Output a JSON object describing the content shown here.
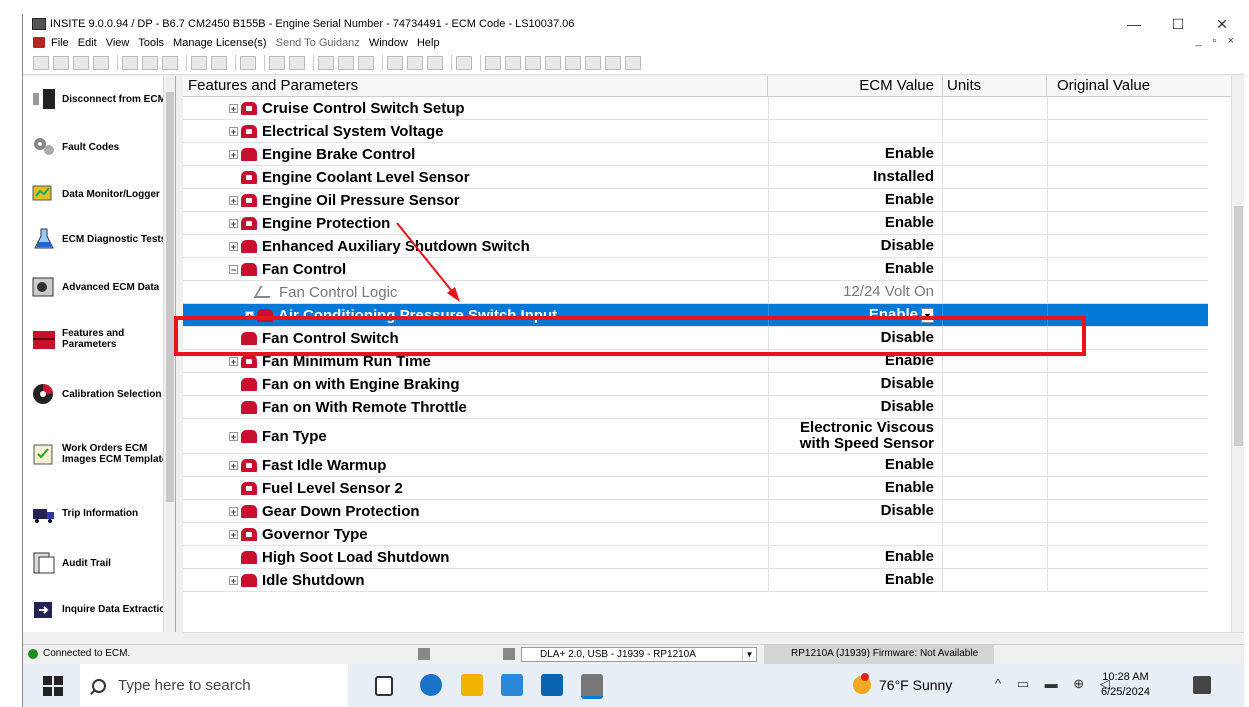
{
  "window": {
    "title": "INSITE 9.0.0.94 / DP - B6.7 CM2450 B155B - Engine Serial Number - 74734491 - ECM Code - LS10037.06",
    "controls": [
      "—",
      "☐",
      "✕"
    ]
  },
  "menu": {
    "items": [
      "File",
      "Edit",
      "View",
      "Tools",
      "Manage License(s)",
      "Send To Guidanz",
      "Window",
      "Help"
    ],
    "mdi_controls": "_ ▫ ×"
  },
  "nav": {
    "items": [
      {
        "label": "Disconnect from ECM",
        "icon": "disconnect-icon"
      },
      {
        "label": "Fault Codes",
        "icon": "gears-icon"
      },
      {
        "label": "Data Monitor/Logger",
        "icon": "monitor-icon"
      },
      {
        "label": "ECM Diagnostic Tests",
        "icon": "flask-icon"
      },
      {
        "label": "Advanced ECM Data",
        "icon": "advanced-data-icon"
      },
      {
        "label": "Features and Parameters",
        "icon": "toolbox-icon"
      },
      {
        "label": "Calibration Selection",
        "icon": "calibration-icon"
      },
      {
        "label": "Work Orders ECM Images ECM Templates",
        "icon": "clipboard-icon"
      },
      {
        "label": "Trip Information",
        "icon": "truck-icon"
      },
      {
        "label": "Audit Trail",
        "icon": "audit-icon"
      },
      {
        "label": "Inquire Data Extraction",
        "icon": "extraction-icon"
      }
    ]
  },
  "grid": {
    "columns": [
      "Features and Parameters",
      "ECM Value",
      "Units",
      "Original Value"
    ],
    "rows": [
      {
        "name": "Cruise Control Switch Setup",
        "value": "",
        "expander": "+",
        "icon": "lock"
      },
      {
        "name": "Electrical System Voltage",
        "value": "",
        "expander": "+",
        "icon": "lock"
      },
      {
        "name": "Engine Brake Control",
        "value": "Enable",
        "expander": "+",
        "icon": "plain"
      },
      {
        "name": "Engine Coolant Level Sensor",
        "value": "Installed",
        "expander": "",
        "icon": "lock"
      },
      {
        "name": "Engine Oil Pressure Sensor",
        "value": "Enable",
        "expander": "+",
        "icon": "lock"
      },
      {
        "name": "Engine Protection",
        "value": "Enable",
        "expander": "+",
        "icon": "lock"
      },
      {
        "name": "Enhanced Auxiliary Shutdown Switch",
        "value": "Disable",
        "expander": "+",
        "icon": "plain"
      },
      {
        "name": "Fan Control",
        "value": "Enable",
        "expander": "−",
        "icon": "plain"
      },
      {
        "name": "Fan Control Logic",
        "value": "12/24 Volt On",
        "expander": "",
        "icon": "child"
      },
      {
        "name": "Air Conditioning Pressure Switch Input",
        "value": "Enable",
        "expander": "+",
        "icon": "plain"
      },
      {
        "name": "Fan Control Switch",
        "value": "Disable",
        "expander": "",
        "icon": "plain"
      },
      {
        "name": "Fan Minimum Run Time",
        "value": "Enable",
        "expander": "+",
        "icon": "lock"
      },
      {
        "name": "Fan on with Engine Braking",
        "value": "Disable",
        "expander": "",
        "icon": "plain"
      },
      {
        "name": "Fan on With Remote Throttle",
        "value": "Disable",
        "expander": "",
        "icon": "plain"
      },
      {
        "name": "Fan Type",
        "value": "Electronic Viscous with Speed Sensor",
        "expander": "+",
        "icon": "plain"
      },
      {
        "name": "Fast Idle Warmup",
        "value": "Enable",
        "expander": "+",
        "icon": "lock"
      },
      {
        "name": "Fuel Level Sensor 2",
        "value": "Enable",
        "expander": "",
        "icon": "lock"
      },
      {
        "name": "Gear Down Protection",
        "value": "Disable",
        "expander": "+",
        "icon": "plain"
      },
      {
        "name": "Governor Type",
        "value": "",
        "expander": "+",
        "icon": "lock"
      },
      {
        "name": "High Soot Load Shutdown",
        "value": "Enable",
        "expander": "",
        "icon": "plain"
      },
      {
        "name": "Idle Shutdown",
        "value": "Enable",
        "expander": "+",
        "icon": "plain"
      }
    ],
    "selected_row": "Air Conditioning Pressure Switch Input"
  },
  "status": {
    "connection": "Connected to ECM.",
    "adapter": "DLA+ 2.0, USB - J1939 - RP1210A",
    "firmware": "RP1210A (J1939)  Firmware: Not Available"
  },
  "taskbar": {
    "search_placeholder": "Type here to search",
    "weather": "76°F  Sunny",
    "time": "10:28 AM",
    "date": "6/25/2024"
  },
  "colors": {
    "selection": "#0078d7",
    "param_icon": "#c8102e",
    "annotation": "#e8141c"
  }
}
